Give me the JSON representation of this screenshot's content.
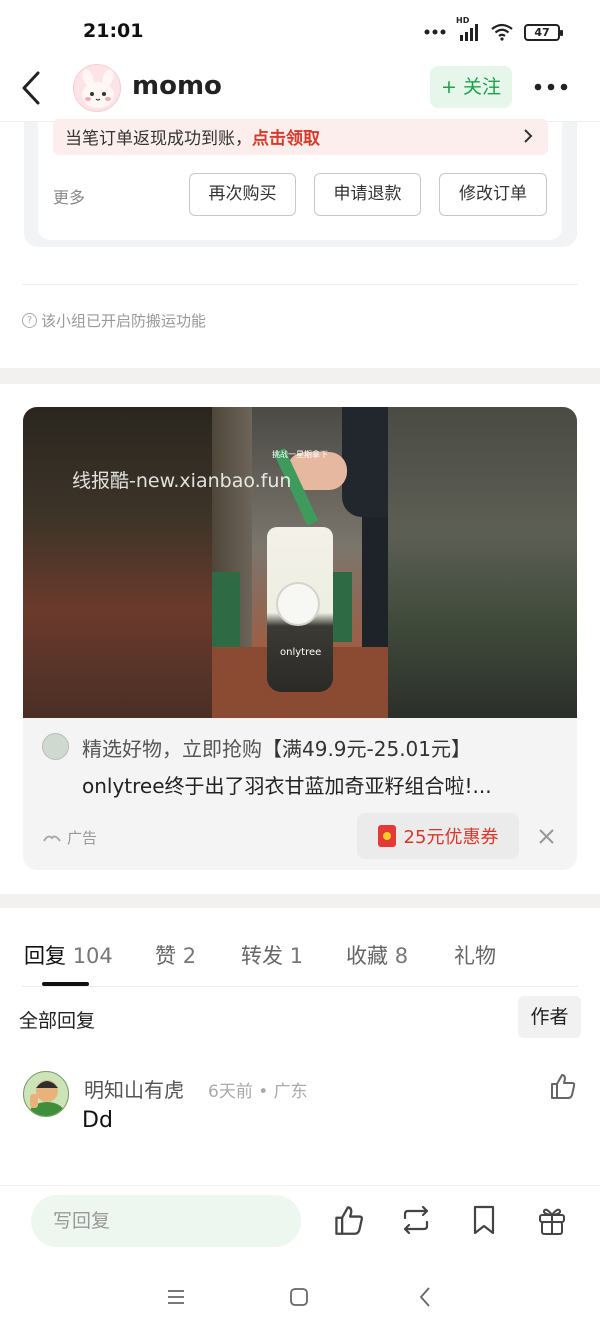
{
  "status_bar": {
    "time": "21:01",
    "network_label": "HD",
    "battery": "47"
  },
  "header": {
    "username": "momo",
    "follow_label": "+ 关注",
    "more_icon": "more-horizontal-icon"
  },
  "order_card": {
    "cashback_text": "当笔订单返现成功到账，",
    "cashback_link": "点击领取",
    "more_label": "更多",
    "buttons": [
      "再次购买",
      "申请退款",
      "修改订单"
    ]
  },
  "notice": {
    "text": "该小组已开启防搬运功能"
  },
  "ad": {
    "watermark": "线报酷-new.xianbao.fun",
    "product_caption": "挑战一星期拿下",
    "product_brand": "onlytree",
    "line1_muted": "精选好物，立即抢购",
    "line1_rest": "【满49.9元-25.01元】",
    "line2": "onlytree终于出了羽衣甘蓝加奇亚籽组合啦!...",
    "tag": "广告",
    "coupon": "25元优惠券",
    "close_icon": "close-icon"
  },
  "tabs": [
    {
      "label": "回复",
      "count": "104"
    },
    {
      "label": "赞",
      "count": "2"
    },
    {
      "label": "转发",
      "count": "1"
    },
    {
      "label": "收藏",
      "count": "8"
    },
    {
      "label": "礼物",
      "count": ""
    }
  ],
  "filter": {
    "all_label": "全部回复",
    "author_label": "作者"
  },
  "comment": {
    "name": "明知山有虎",
    "meta": "6天前 • 广东",
    "text": "Dd"
  },
  "bottom_bar": {
    "placeholder": "写回复"
  },
  "colors": {
    "accent_green": "#1fa14a",
    "link_red": "#d93a2a"
  }
}
